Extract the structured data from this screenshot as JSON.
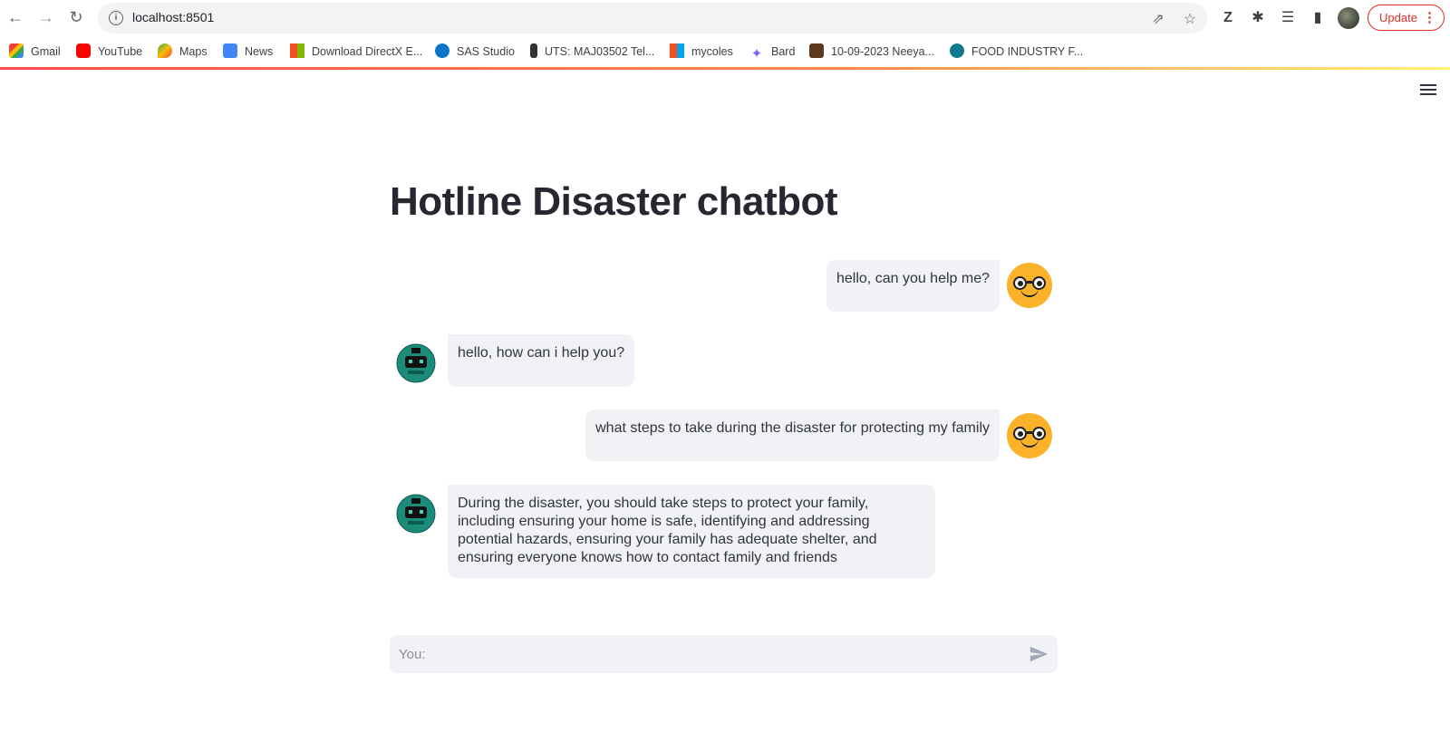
{
  "browser": {
    "url": "localhost:8501",
    "update_label": "Update",
    "bookmarks": [
      {
        "label": "Gmail"
      },
      {
        "label": "YouTube"
      },
      {
        "label": "Maps"
      },
      {
        "label": "News"
      },
      {
        "label": "Download DirectX E..."
      },
      {
        "label": "SAS Studio"
      },
      {
        "label": "UTS: MAJ03502 Tel..."
      },
      {
        "label": "mycoles"
      },
      {
        "label": "Bard"
      },
      {
        "label": "10-09-2023 Neeya..."
      },
      {
        "label": "FOOD INDUSTRY F..."
      }
    ]
  },
  "app": {
    "title": "Hotline Disaster chatbot",
    "messages": [
      {
        "role": "user",
        "text": "hello, can you help me?"
      },
      {
        "role": "bot",
        "text": "hello, how can i help you?"
      },
      {
        "role": "user",
        "text": "what steps to take during the disaster for protecting my family"
      },
      {
        "role": "bot",
        "text": "During the disaster, you should take steps to protect your family, including ensuring your home is safe, identifying and addressing potential hazards, ensuring your family has adequate shelter, and ensuring everyone knows how to contact family and friends"
      }
    ],
    "input_placeholder": "You:"
  },
  "colors": {
    "accent": "#ff4b4b",
    "bubble_bg": "#f0f2f6",
    "user_avatar": "#fbb22a",
    "bot_avatar": "#1c8c7a"
  }
}
